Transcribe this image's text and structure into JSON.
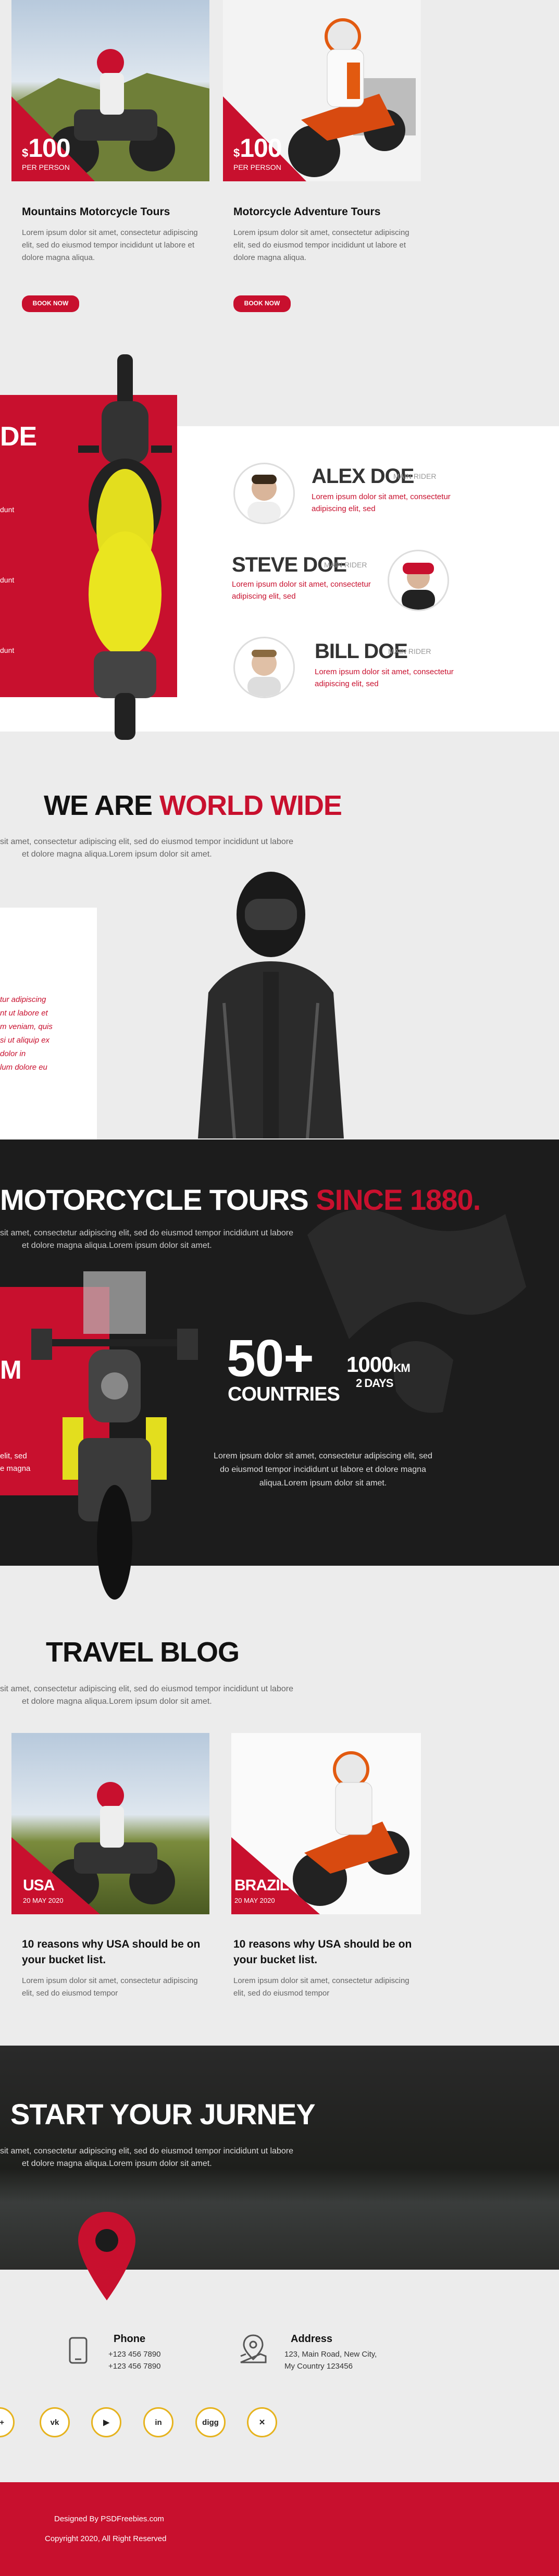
{
  "tours": [
    {
      "price_symbol": "$",
      "price": "100",
      "price_note": "PER PERSON",
      "title": "Mountains Motorcycle Tours",
      "desc": "Lorem ipsum dolor sit amet, consectetur adipiscing elit, sed do eiusmod tempor incididunt ut labore et dolore magna aliqua.",
      "button": "BOOK NOW"
    },
    {
      "price_symbol": "$",
      "price": "100",
      "price_note": "PER PERSON",
      "title": "Motorcycle Adventure Tours",
      "desc": "Lorem ipsum dolor sit amet, consectetur adipiscing elit, sed do eiusmod tempor incididunt ut labore et dolore magna aliqua.",
      "button": "BOOK NOW"
    }
  ],
  "riders_section": {
    "heading_partial": "DE",
    "side_texts": [
      "dunt",
      "dunt",
      "dunt"
    ],
    "riders": [
      {
        "name": "ALEX DOE",
        "role": "MAIN RIDER",
        "desc": "Lorem ipsum dolor sit amet, consectetur adipiscing elit, sed"
      },
      {
        "name": "STEVE DOE",
        "role": "MAIN RIDER",
        "desc": "Lorem ipsum dolor sit amet, consectetur adipiscing elit, sed"
      },
      {
        "name": "BILL DOE",
        "role": "MAIN RIDER",
        "desc": "Lorem ipsum dolor sit amet, consectetur adipiscing elit, sed"
      }
    ]
  },
  "world": {
    "heading_a": "WE ARE",
    "heading_b": "WORLD WIDE",
    "sub1": "sit amet, consectetur adipiscing elit, sed do eiusmod tempor incididunt ut labore",
    "sub2": "et dolore magna aliqua.Lorem ipsum dolor sit amet.",
    "card_lines": [
      "tur adipiscing",
      "nt ut labore et",
      "m veniam, quis",
      "si ut aliquip ex",
      "dolor in",
      "lum dolore eu"
    ]
  },
  "since": {
    "heading_a": "MOTORCYCLE TOURS",
    "heading_b": "SINCE 1880.",
    "sub1": "sit amet, consectetur adipiscing elit, sed do eiusmod tempor incididunt ut labore",
    "sub2": "et dolore magna aliqua.Lorem ipsum dolor sit amet.",
    "left_big": "M",
    "left_lines": [
      "elit, sed",
      "e magna"
    ],
    "stat_num": "50+",
    "stat_label": "COUNTRIES",
    "km_num": "1000",
    "km_unit": "KM",
    "km_label": "2 DAYS",
    "desc1": "Lorem ipsum dolor sit amet, consectetur adipiscing elit, sed",
    "desc2": "do eiusmod tempor incididunt ut labore et dolore magna",
    "desc3": "aliqua.Lorem ipsum dolor sit amet."
  },
  "blog": {
    "heading": "TRAVEL BLOG",
    "sub1": "sit amet, consectetur adipiscing elit, sed do eiusmod tempor incididunt ut labore",
    "sub2": "et dolore magna aliqua.Lorem ipsum dolor sit amet.",
    "posts": [
      {
        "place": "USA",
        "date": "20 MAY 2020",
        "title": "10 reasons why USA should be on your bucket list.",
        "desc": "Lorem ipsum dolor sit amet, consectetur adipiscing elit, sed do eiusmod tempor"
      },
      {
        "place": "BRAZIL",
        "date": "20 MAY 2020",
        "title": "10 reasons why USA should be on your bucket list.",
        "desc": "Lorem ipsum dolor sit amet, consectetur adipiscing elit, sed do eiusmod tempor"
      }
    ]
  },
  "journey": {
    "heading": "START YOUR JURNEY",
    "sub1": "sit amet, consectetur adipiscing elit, sed do eiusmod tempor incididunt ut labore",
    "sub2": "et dolore magna aliqua.Lorem ipsum dolor sit amet."
  },
  "contact": {
    "phone_label": "Phone",
    "phone1": "+123 456 7890",
    "phone2": "+123 456 7890",
    "address_label": "Address",
    "address1": "123, Main Road, New City,",
    "address2": "My Country 123456"
  },
  "social": [
    "g+",
    "vk",
    "▶",
    "in",
    "digg",
    "✕"
  ],
  "footer": {
    "line1": "Designed By PSDFreebies.com",
    "line2": "Copyright 2020, All Right Reserved"
  },
  "colors": {
    "accent": "#c8102e",
    "dark": "#1c1c1c",
    "gold": "#e6b31e"
  }
}
